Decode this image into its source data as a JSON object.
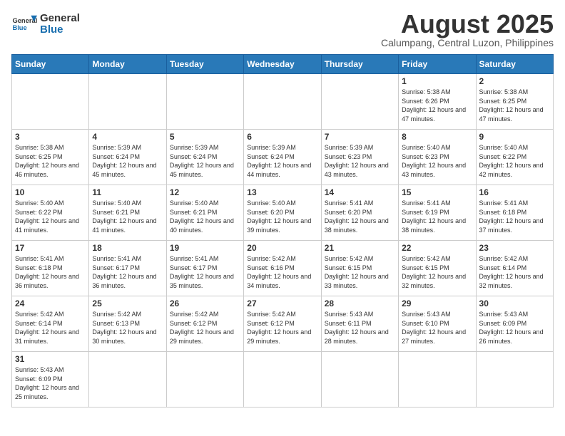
{
  "header": {
    "logo_general": "General",
    "logo_blue": "Blue",
    "title": "August 2025",
    "subtitle": "Calumpang, Central Luzon, Philippines"
  },
  "weekdays": [
    "Sunday",
    "Monday",
    "Tuesday",
    "Wednesday",
    "Thursday",
    "Friday",
    "Saturday"
  ],
  "weeks": [
    [
      {
        "day": "",
        "info": ""
      },
      {
        "day": "",
        "info": ""
      },
      {
        "day": "",
        "info": ""
      },
      {
        "day": "",
        "info": ""
      },
      {
        "day": "",
        "info": ""
      },
      {
        "day": "1",
        "info": "Sunrise: 5:38 AM\nSunset: 6:26 PM\nDaylight: 12 hours\nand 47 minutes."
      },
      {
        "day": "2",
        "info": "Sunrise: 5:38 AM\nSunset: 6:25 PM\nDaylight: 12 hours\nand 47 minutes."
      }
    ],
    [
      {
        "day": "3",
        "info": "Sunrise: 5:38 AM\nSunset: 6:25 PM\nDaylight: 12 hours\nand 46 minutes."
      },
      {
        "day": "4",
        "info": "Sunrise: 5:39 AM\nSunset: 6:24 PM\nDaylight: 12 hours\nand 45 minutes."
      },
      {
        "day": "5",
        "info": "Sunrise: 5:39 AM\nSunset: 6:24 PM\nDaylight: 12 hours\nand 45 minutes."
      },
      {
        "day": "6",
        "info": "Sunrise: 5:39 AM\nSunset: 6:24 PM\nDaylight: 12 hours\nand 44 minutes."
      },
      {
        "day": "7",
        "info": "Sunrise: 5:39 AM\nSunset: 6:23 PM\nDaylight: 12 hours\nand 43 minutes."
      },
      {
        "day": "8",
        "info": "Sunrise: 5:40 AM\nSunset: 6:23 PM\nDaylight: 12 hours\nand 43 minutes."
      },
      {
        "day": "9",
        "info": "Sunrise: 5:40 AM\nSunset: 6:22 PM\nDaylight: 12 hours\nand 42 minutes."
      }
    ],
    [
      {
        "day": "10",
        "info": "Sunrise: 5:40 AM\nSunset: 6:22 PM\nDaylight: 12 hours\nand 41 minutes."
      },
      {
        "day": "11",
        "info": "Sunrise: 5:40 AM\nSunset: 6:21 PM\nDaylight: 12 hours\nand 41 minutes."
      },
      {
        "day": "12",
        "info": "Sunrise: 5:40 AM\nSunset: 6:21 PM\nDaylight: 12 hours\nand 40 minutes."
      },
      {
        "day": "13",
        "info": "Sunrise: 5:40 AM\nSunset: 6:20 PM\nDaylight: 12 hours\nand 39 minutes."
      },
      {
        "day": "14",
        "info": "Sunrise: 5:41 AM\nSunset: 6:20 PM\nDaylight: 12 hours\nand 38 minutes."
      },
      {
        "day": "15",
        "info": "Sunrise: 5:41 AM\nSunset: 6:19 PM\nDaylight: 12 hours\nand 38 minutes."
      },
      {
        "day": "16",
        "info": "Sunrise: 5:41 AM\nSunset: 6:18 PM\nDaylight: 12 hours\nand 37 minutes."
      }
    ],
    [
      {
        "day": "17",
        "info": "Sunrise: 5:41 AM\nSunset: 6:18 PM\nDaylight: 12 hours\nand 36 minutes."
      },
      {
        "day": "18",
        "info": "Sunrise: 5:41 AM\nSunset: 6:17 PM\nDaylight: 12 hours\nand 36 minutes."
      },
      {
        "day": "19",
        "info": "Sunrise: 5:41 AM\nSunset: 6:17 PM\nDaylight: 12 hours\nand 35 minutes."
      },
      {
        "day": "20",
        "info": "Sunrise: 5:42 AM\nSunset: 6:16 PM\nDaylight: 12 hours\nand 34 minutes."
      },
      {
        "day": "21",
        "info": "Sunrise: 5:42 AM\nSunset: 6:15 PM\nDaylight: 12 hours\nand 33 minutes."
      },
      {
        "day": "22",
        "info": "Sunrise: 5:42 AM\nSunset: 6:15 PM\nDaylight: 12 hours\nand 32 minutes."
      },
      {
        "day": "23",
        "info": "Sunrise: 5:42 AM\nSunset: 6:14 PM\nDaylight: 12 hours\nand 32 minutes."
      }
    ],
    [
      {
        "day": "24",
        "info": "Sunrise: 5:42 AM\nSunset: 6:14 PM\nDaylight: 12 hours\nand 31 minutes."
      },
      {
        "day": "25",
        "info": "Sunrise: 5:42 AM\nSunset: 6:13 PM\nDaylight: 12 hours\nand 30 minutes."
      },
      {
        "day": "26",
        "info": "Sunrise: 5:42 AM\nSunset: 6:12 PM\nDaylight: 12 hours\nand 29 minutes."
      },
      {
        "day": "27",
        "info": "Sunrise: 5:42 AM\nSunset: 6:12 PM\nDaylight: 12 hours\nand 29 minutes."
      },
      {
        "day": "28",
        "info": "Sunrise: 5:43 AM\nSunset: 6:11 PM\nDaylight: 12 hours\nand 28 minutes."
      },
      {
        "day": "29",
        "info": "Sunrise: 5:43 AM\nSunset: 6:10 PM\nDaylight: 12 hours\nand 27 minutes."
      },
      {
        "day": "30",
        "info": "Sunrise: 5:43 AM\nSunset: 6:09 PM\nDaylight: 12 hours\nand 26 minutes."
      }
    ],
    [
      {
        "day": "31",
        "info": "Sunrise: 5:43 AM\nSunset: 6:09 PM\nDaylight: 12 hours\nand 25 minutes."
      },
      {
        "day": "",
        "info": ""
      },
      {
        "day": "",
        "info": ""
      },
      {
        "day": "",
        "info": ""
      },
      {
        "day": "",
        "info": ""
      },
      {
        "day": "",
        "info": ""
      },
      {
        "day": "",
        "info": ""
      }
    ]
  ]
}
